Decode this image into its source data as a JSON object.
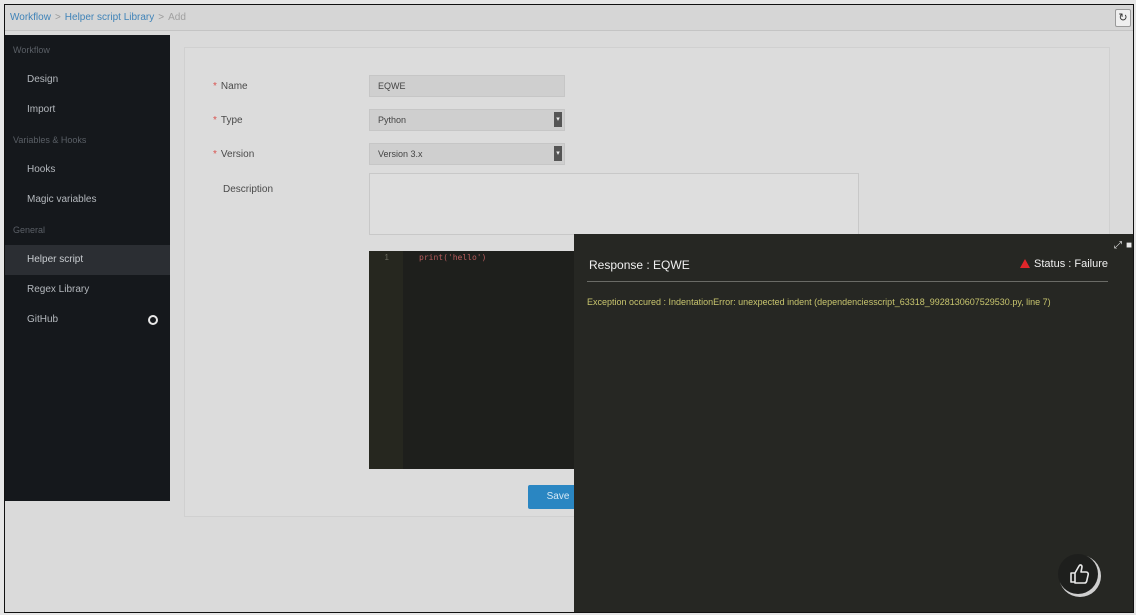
{
  "breadcrumb": {
    "items": [
      "Workflow",
      "Helper script Library"
    ],
    "current": "Add",
    "separator": ">"
  },
  "toolbar": {
    "refresh_icon": "↻"
  },
  "sidebar": {
    "section_workflow": "Workflow",
    "item_design": "Design",
    "item_import": "Import",
    "section_variables": "Variables & Hooks",
    "item_hooks": "Hooks",
    "item_magic": "Magic variables",
    "section_general": "General",
    "item_helper": "Helper script",
    "item_regex": "Regex Library",
    "item_github": "GitHub"
  },
  "form": {
    "name_label": "Name",
    "name_value": "EQWE",
    "type_label": "Type",
    "type_value": "Python",
    "version_label": "Version",
    "version_value": "Version 3.x",
    "description_label": "Description",
    "required_mark": "*",
    "save_label": "Save"
  },
  "editor": {
    "line_number": "1",
    "code": "print('hello')"
  },
  "response": {
    "title": "Response : EQWE",
    "status": "Status : Failure",
    "message": "Exception occured : IndentationError: unexpected indent (dependenciesscript_63318_9928130607529530.py, line 7)"
  },
  "colors": {
    "accent": "#2a86c2",
    "error": "#e0262a",
    "sidebar_bg": "#15181c",
    "panel_bg": "#262723",
    "message": "#c8c56e"
  }
}
